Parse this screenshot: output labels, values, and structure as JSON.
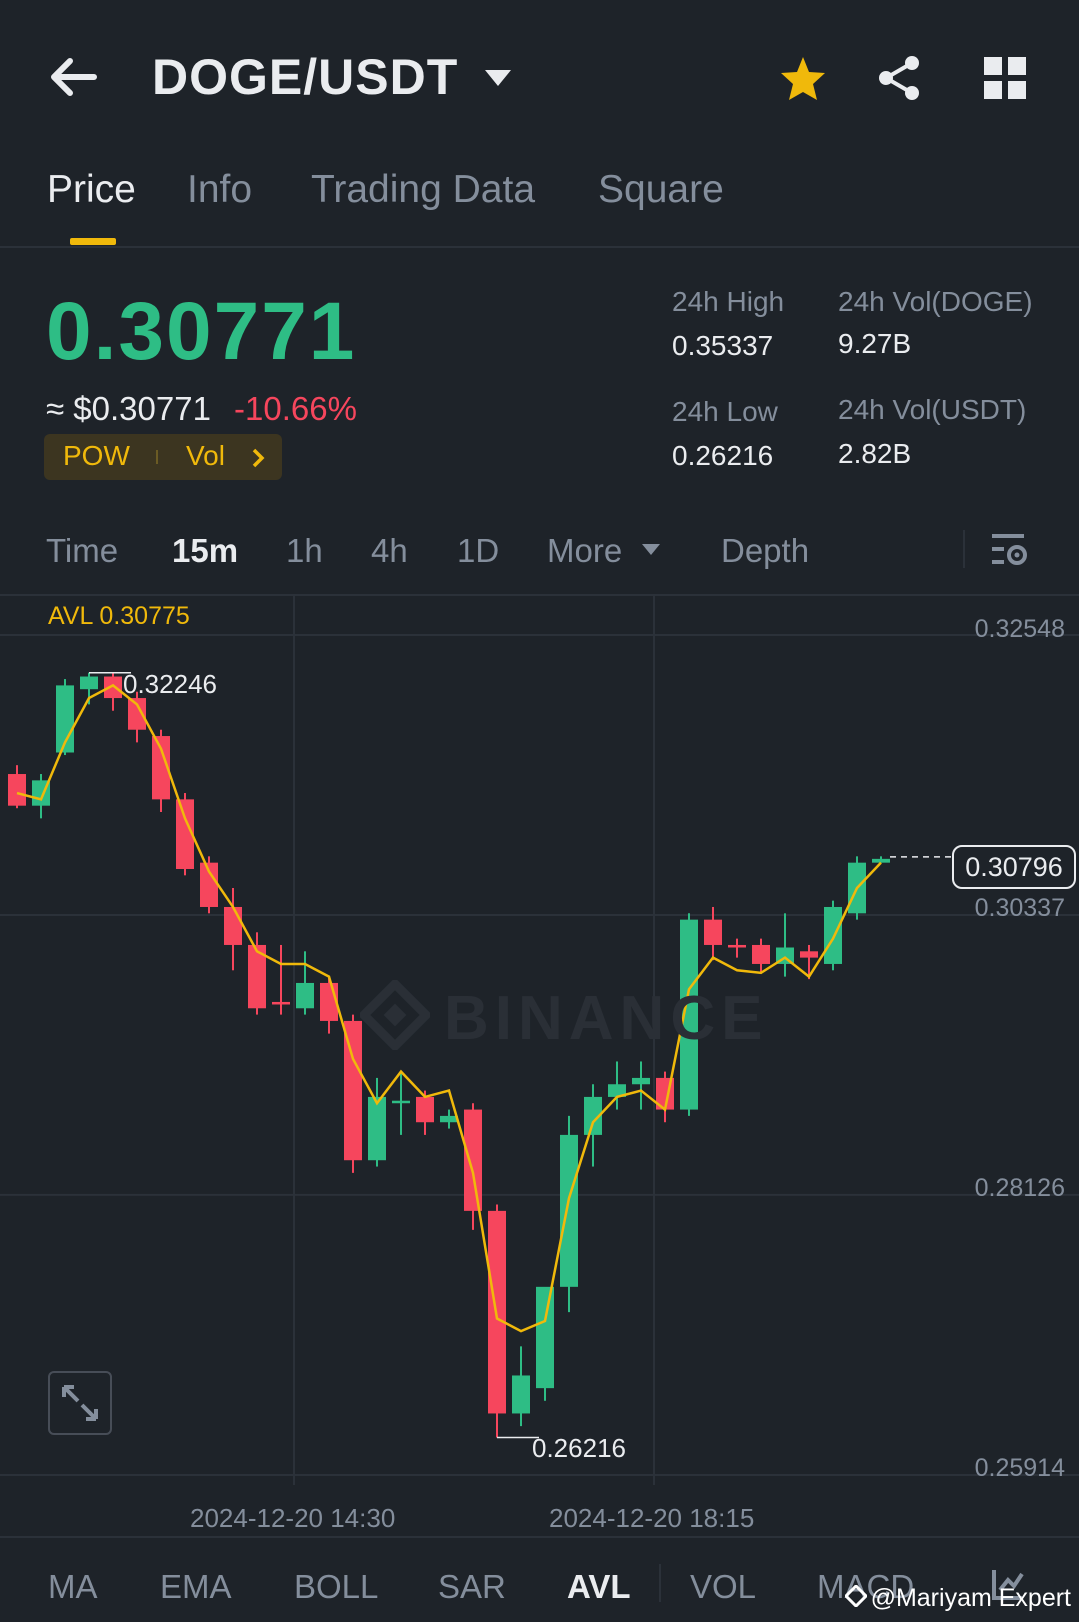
{
  "header": {
    "pair": "DOGE/USDT"
  },
  "tabs": [
    "Price",
    "Info",
    "Trading Data",
    "Square"
  ],
  "ticker": {
    "last_price": "0.30771",
    "fiat_price": "≈ $0.30771",
    "change": "-10.66%",
    "tag_pow": "POW",
    "tag_vol": "Vol"
  },
  "stats": {
    "high_label": "24h High",
    "high_value": "0.35337",
    "vol_doge_label": "24h Vol(DOGE)",
    "vol_doge_value": "9.27B",
    "low_label": "24h Low",
    "low_value": "0.26216",
    "vol_usdt_label": "24h Vol(USDT)",
    "vol_usdt_value": "2.82B"
  },
  "timeframes": [
    "Time",
    "15m",
    "1h",
    "4h",
    "1D",
    "More",
    "Depth"
  ],
  "chart": {
    "avl_label": "AVL 0.30775",
    "y_ticks": [
      "0.32548",
      "0.30337",
      "0.28126",
      "0.25914"
    ],
    "x_ticks": [
      "2024-12-20 14:30",
      "2024-12-20 18:15"
    ],
    "high_marker": "0.32246",
    "low_marker": "0.26216",
    "current_price_tag": "0.30796",
    "watermark": "BINANCE"
  },
  "indicators": [
    "MA",
    "EMA",
    "BOLL",
    "SAR",
    "AVL",
    "VOL",
    "MACD"
  ],
  "credit": "@Mariyam Expert",
  "colors": {
    "up": "#2ebd85",
    "down": "#f6465d",
    "accent": "#f0b90b",
    "bg": "#1e2329"
  },
  "chart_data": {
    "type": "candlestick",
    "interval": "15m",
    "ylim": [
      0.25914,
      0.32548
    ],
    "candles": [
      {
        "o": 0.3145,
        "h": 0.3152,
        "l": 0.3118,
        "c": 0.312
      },
      {
        "o": 0.312,
        "h": 0.3145,
        "l": 0.311,
        "c": 0.314
      },
      {
        "o": 0.3162,
        "h": 0.322,
        "l": 0.316,
        "c": 0.3215
      },
      {
        "o": 0.3212,
        "h": 0.3225,
        "l": 0.32,
        "c": 0.3222
      },
      {
        "o": 0.3222,
        "h": 0.3225,
        "l": 0.3195,
        "c": 0.3205
      },
      {
        "o": 0.3205,
        "h": 0.321,
        "l": 0.317,
        "c": 0.318
      },
      {
        "o": 0.3175,
        "h": 0.318,
        "l": 0.3115,
        "c": 0.3125
      },
      {
        "o": 0.3125,
        "h": 0.313,
        "l": 0.3065,
        "c": 0.307
      },
      {
        "o": 0.3075,
        "h": 0.308,
        "l": 0.3035,
        "c": 0.304
      },
      {
        "o": 0.304,
        "h": 0.3055,
        "l": 0.299,
        "c": 0.301
      },
      {
        "o": 0.301,
        "h": 0.302,
        "l": 0.2955,
        "c": 0.296
      },
      {
        "o": 0.2965,
        "h": 0.301,
        "l": 0.2955,
        "c": 0.2963
      },
      {
        "o": 0.296,
        "h": 0.3005,
        "l": 0.2955,
        "c": 0.298
      },
      {
        "o": 0.298,
        "h": 0.2985,
        "l": 0.294,
        "c": 0.295
      },
      {
        "o": 0.295,
        "h": 0.2955,
        "l": 0.283,
        "c": 0.284
      },
      {
        "o": 0.284,
        "h": 0.2905,
        "l": 0.2835,
        "c": 0.289
      },
      {
        "o": 0.2885,
        "h": 0.291,
        "l": 0.286,
        "c": 0.2887
      },
      {
        "o": 0.289,
        "h": 0.2895,
        "l": 0.286,
        "c": 0.287
      },
      {
        "o": 0.287,
        "h": 0.288,
        "l": 0.2865,
        "c": 0.2875
      },
      {
        "o": 0.288,
        "h": 0.2885,
        "l": 0.2785,
        "c": 0.28
      },
      {
        "o": 0.28,
        "h": 0.2805,
        "l": 0.2621,
        "c": 0.264
      },
      {
        "o": 0.264,
        "h": 0.2693,
        "l": 0.263,
        "c": 0.267
      },
      {
        "o": 0.266,
        "h": 0.27,
        "l": 0.265,
        "c": 0.274
      },
      {
        "o": 0.274,
        "h": 0.2875,
        "l": 0.272,
        "c": 0.286
      },
      {
        "o": 0.286,
        "h": 0.29,
        "l": 0.2835,
        "c": 0.289
      },
      {
        "o": 0.289,
        "h": 0.2918,
        "l": 0.288,
        "c": 0.29
      },
      {
        "o": 0.29,
        "h": 0.2918,
        "l": 0.288,
        "c": 0.2905
      },
      {
        "o": 0.2905,
        "h": 0.291,
        "l": 0.287,
        "c": 0.288
      },
      {
        "o": 0.288,
        "h": 0.3035,
        "l": 0.2875,
        "c": 0.303
      },
      {
        "o": 0.303,
        "h": 0.304,
        "l": 0.2998,
        "c": 0.301
      },
      {
        "o": 0.301,
        "h": 0.3015,
        "l": 0.3,
        "c": 0.3008
      },
      {
        "o": 0.301,
        "h": 0.3015,
        "l": 0.2988,
        "c": 0.2995
      },
      {
        "o": 0.2995,
        "h": 0.3035,
        "l": 0.2985,
        "c": 0.3008
      },
      {
        "o": 0.3005,
        "h": 0.301,
        "l": 0.2983,
        "c": 0.3
      },
      {
        "o": 0.2995,
        "h": 0.3045,
        "l": 0.299,
        "c": 0.304
      },
      {
        "o": 0.3035,
        "h": 0.308,
        "l": 0.303,
        "c": 0.3075
      },
      {
        "o": 0.3075,
        "h": 0.308,
        "l": 0.3075,
        "c": 0.3078
      }
    ],
    "avl": [
      0.313,
      0.3125,
      0.317,
      0.3205,
      0.3215,
      0.32,
      0.3165,
      0.311,
      0.3068,
      0.304,
      0.3005,
      0.2995,
      0.2995,
      0.2985,
      0.292,
      0.2885,
      0.291,
      0.289,
      0.2895,
      0.283,
      0.2715,
      0.2705,
      0.2713,
      0.281,
      0.287,
      0.289,
      0.2895,
      0.288,
      0.2975,
      0.3,
      0.299,
      0.2988,
      0.3,
      0.2985,
      0.3015,
      0.3055,
      0.3075
    ]
  }
}
